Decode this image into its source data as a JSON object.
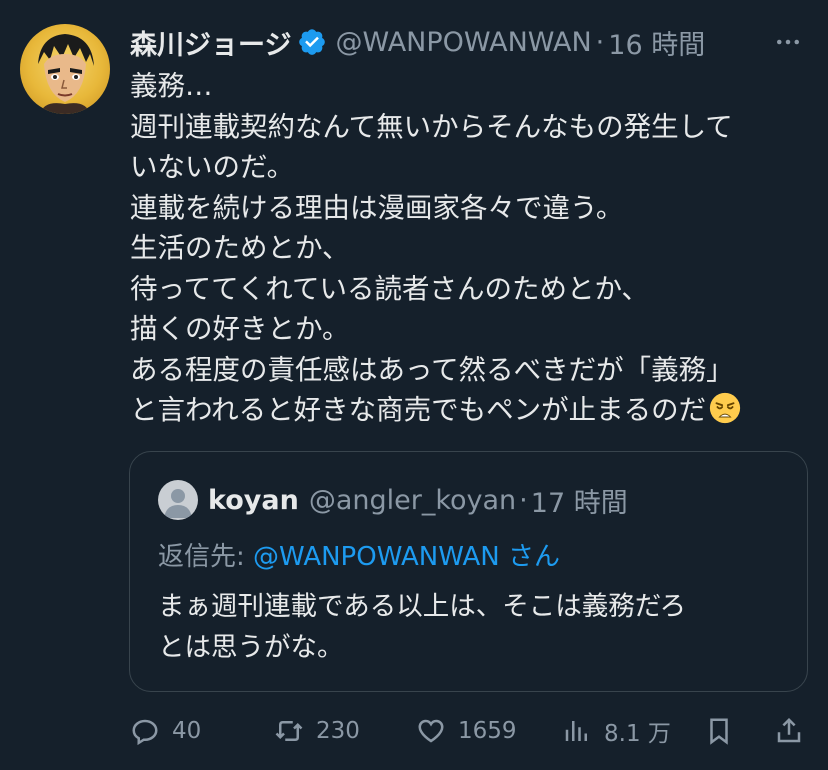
{
  "tweet": {
    "author_name": "森川ジョージ",
    "handle": "@WANPOWANWAN",
    "separator": "·",
    "time": "16 時間",
    "more_icon": "more-horizontal-icon",
    "lines": [
      "義務…",
      "週刊連載契約なんて無いからそんなもの発生して",
      "いないのだ。",
      "連載を続ける理由は漫画家各々で違う。",
      "生活のためとか、",
      "待っててくれている読者さんのためとか、",
      "描くの好きとか。",
      "ある程度の責任感はあって然るべきだが「義務」",
      "と言われると好きな商売でもペンが止まるのだ"
    ],
    "emoji": "weary-face",
    "accent_color": "#1d9bf0"
  },
  "quote": {
    "author_name": "koyan",
    "handle": "@angler_koyan",
    "separator": "·",
    "time": "17 時間",
    "reply_prefix": "返信先: ",
    "reply_mention": "@WANPOWANWAN さん",
    "lines": [
      "まぁ週刊連載である以上は、そこは義務だろ",
      "とは思うがな。"
    ]
  },
  "actions": {
    "replies": "40",
    "retweets": "230",
    "likes": "1659",
    "views": "8.1 万"
  }
}
